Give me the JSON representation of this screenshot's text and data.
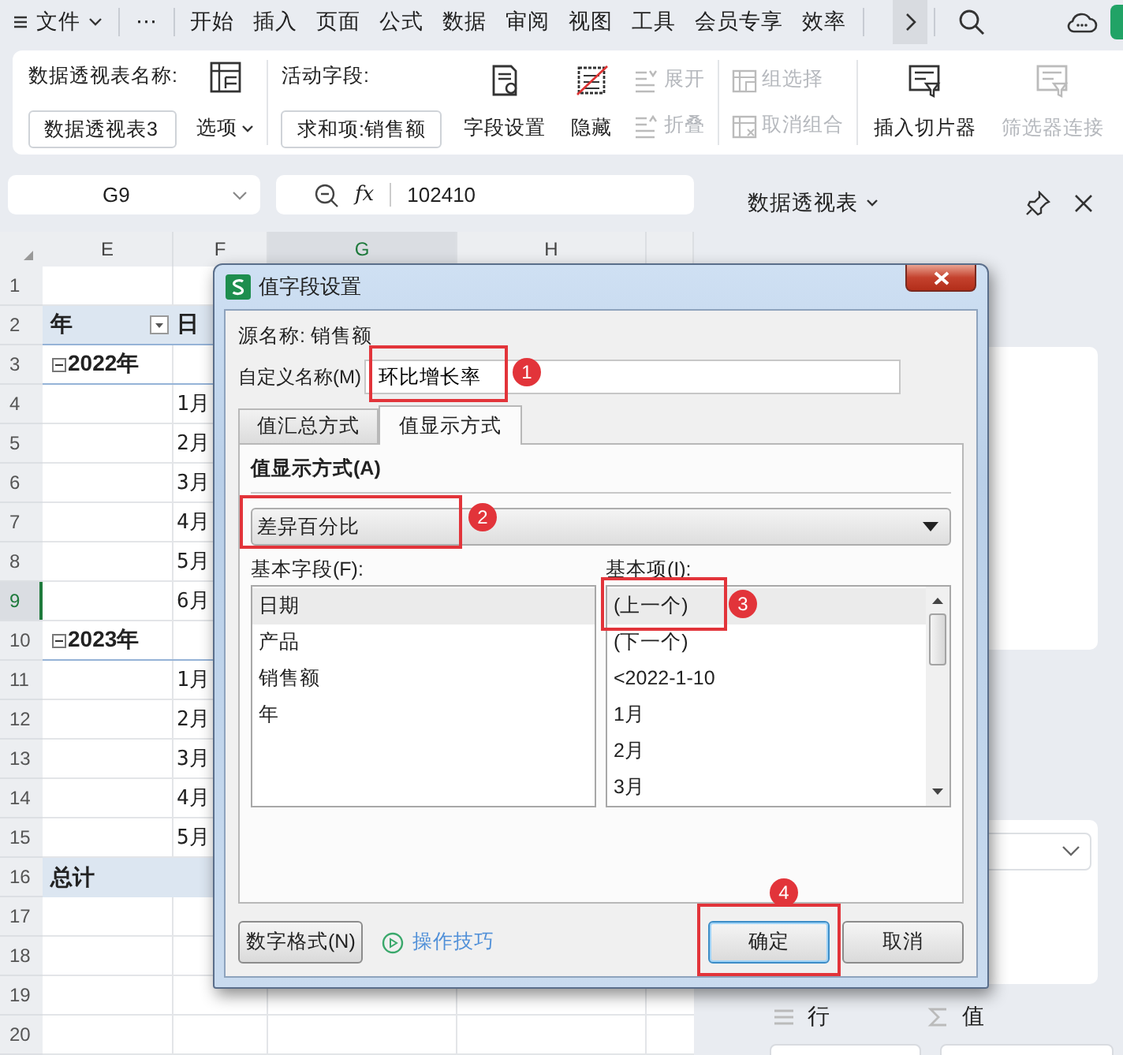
{
  "menu_bar": {
    "items": [
      {
        "label": "文件",
        "kind": "file",
        "selected": false
      },
      {
        "label": "⋯",
        "kind": "more",
        "selected": false
      },
      {
        "label": "开始",
        "kind": "tab",
        "selected": false
      },
      {
        "label": "插入",
        "kind": "tab",
        "selected": false
      },
      {
        "label": "页面",
        "kind": "tab",
        "selected": false
      },
      {
        "label": "公式",
        "kind": "tab",
        "selected": false
      },
      {
        "label": "数据",
        "kind": "tab",
        "selected": false
      },
      {
        "label": "审阅",
        "kind": "tab",
        "selected": false
      },
      {
        "label": "视图",
        "kind": "tab",
        "selected": false
      },
      {
        "label": "工具",
        "kind": "tab",
        "selected": false
      },
      {
        "label": "会员专享",
        "kind": "tab",
        "selected": false
      },
      {
        "label": "效率",
        "kind": "tab",
        "selected": false
      }
    ]
  },
  "ribbon": {
    "groups": [
      {
        "label": "数据透视表名称:",
        "value": "数据透视表3",
        "option": "选项"
      },
      {
        "label": "活动字段:",
        "value": "求和项:销售额",
        "buttons": [
          {
            "label": "字段设置",
            "kind": "large",
            "disabled": false
          },
          {
            "label": "隐藏",
            "kind": "large",
            "disabled": false
          },
          {
            "label": "展开",
            "kind": "small",
            "disabled": true
          },
          {
            "label": "折叠",
            "kind": "small",
            "disabled": true
          }
        ]
      },
      {
        "buttons": [
          {
            "label": "组选择",
            "kind": "small",
            "disabled": true
          },
          {
            "label": "取消组合",
            "kind": "small",
            "disabled": true
          }
        ]
      },
      {
        "buttons": [
          {
            "label": "插入切片器",
            "kind": "large",
            "disabled": false
          },
          {
            "label": "筛选器连接",
            "kind": "large",
            "disabled": true
          }
        ]
      }
    ]
  },
  "name_box": "G9",
  "function_label": "fx",
  "formula": "102410",
  "sheet": {
    "columns": [
      {
        "label": "E",
        "selected": false
      },
      {
        "label": "F",
        "selected": false
      },
      {
        "label": "G",
        "selected": true
      },
      {
        "label": "H",
        "selected": false
      }
    ],
    "rows": [
      {
        "number": "1",
        "kind": "blank",
        "selected": false
      },
      {
        "number": "2",
        "kind": "header",
        "e": "年",
        "f": "日",
        "selected": false
      },
      {
        "number": "3",
        "kind": "group",
        "e": "2022年",
        "selected": false
      },
      {
        "number": "4",
        "kind": "item",
        "f": "1月",
        "selected": false
      },
      {
        "number": "5",
        "kind": "item",
        "f": "2月",
        "selected": false
      },
      {
        "number": "6",
        "kind": "item",
        "f": "3月",
        "selected": false
      },
      {
        "number": "7",
        "kind": "item",
        "f": "4月",
        "selected": false
      },
      {
        "number": "8",
        "kind": "item",
        "f": "5月",
        "selected": false
      },
      {
        "number": "9",
        "kind": "item",
        "f": "6月",
        "selected": true
      },
      {
        "number": "10",
        "kind": "group",
        "e": "2023年",
        "selected": false
      },
      {
        "number": "11",
        "kind": "item",
        "f": "1月",
        "selected": false
      },
      {
        "number": "12",
        "kind": "item",
        "f": "2月",
        "selected": false
      },
      {
        "number": "13",
        "kind": "item",
        "f": "3月",
        "selected": false
      },
      {
        "number": "14",
        "kind": "item",
        "f": "4月",
        "selected": false
      },
      {
        "number": "15",
        "kind": "item",
        "f": "5月",
        "selected": false
      },
      {
        "number": "16",
        "kind": "total",
        "e": "总计",
        "selected": false
      },
      {
        "number": "17",
        "kind": "blank",
        "selected": false
      },
      {
        "number": "18",
        "kind": "blank",
        "selected": false
      },
      {
        "number": "19",
        "kind": "blank",
        "selected": false
      },
      {
        "number": "20",
        "kind": "blank",
        "selected": false
      }
    ]
  },
  "side_panel": {
    "title": "数据透视表",
    "areas": [
      {
        "label": "行"
      },
      {
        "label": "值"
      }
    ]
  },
  "dialog": {
    "title": "值字段设置",
    "source_label": "源名称: 销售额",
    "custom_name_label": "自定义名称(M)",
    "custom_name": "环比增长率",
    "tabs": [
      {
        "label": "值汇总方式",
        "selected": false
      },
      {
        "label": "值显示方式",
        "selected": true
      }
    ],
    "section_label": "值显示方式(A)",
    "show_as": "差异百分比",
    "base_field_label": "基本字段(F):",
    "base_fields": [
      {
        "label": "日期",
        "selected": true
      },
      {
        "label": "产品",
        "selected": false
      },
      {
        "label": "销售额",
        "selected": false
      },
      {
        "label": "年",
        "selected": false
      }
    ],
    "base_item_label": "基本项(I):",
    "base_items": [
      {
        "label": "(上一个)",
        "selected": true
      },
      {
        "label": "(下一个)",
        "selected": false
      },
      {
        "label": "<2022-1-10",
        "selected": false
      },
      {
        "label": "1月",
        "selected": false
      },
      {
        "label": "2月",
        "selected": false
      },
      {
        "label": "3月",
        "selected": false
      }
    ],
    "number_format_button": "数字格式(N)",
    "tips_link": "操作技巧",
    "ok_button": "确定",
    "cancel_button": "取消",
    "callouts": [
      "1",
      "2",
      "3",
      "4"
    ]
  }
}
